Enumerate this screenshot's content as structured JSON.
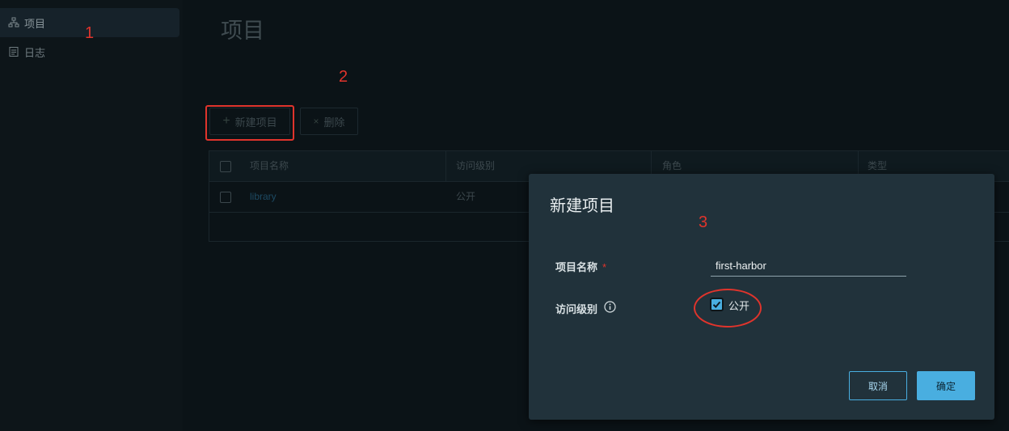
{
  "sidebar": {
    "items": [
      {
        "label": "项目",
        "icon": "project-tree-icon",
        "active": true
      },
      {
        "label": "日志",
        "icon": "log-document-icon",
        "active": false
      }
    ]
  },
  "page": {
    "title": "项目"
  },
  "toolbar": {
    "new_project": "新建项目",
    "delete": "删除"
  },
  "table": {
    "columns": [
      "项目名称",
      "访问级别",
      "角色",
      "类型"
    ],
    "rows": [
      {
        "name": "library",
        "access": "公开"
      }
    ]
  },
  "modal": {
    "title": "新建项目",
    "name_label": "项目名称",
    "required_mark": "*",
    "name_value": "first-harbor",
    "access_label": "访问级别",
    "public_label": "公开",
    "public_checked": true,
    "cancel": "取消",
    "ok": "确定"
  },
  "annotations": [
    "1",
    "2",
    "3"
  ],
  "colors": {
    "accent": "#49aee0",
    "annotation": "#e0342c",
    "modal_bg": "#21323b"
  }
}
